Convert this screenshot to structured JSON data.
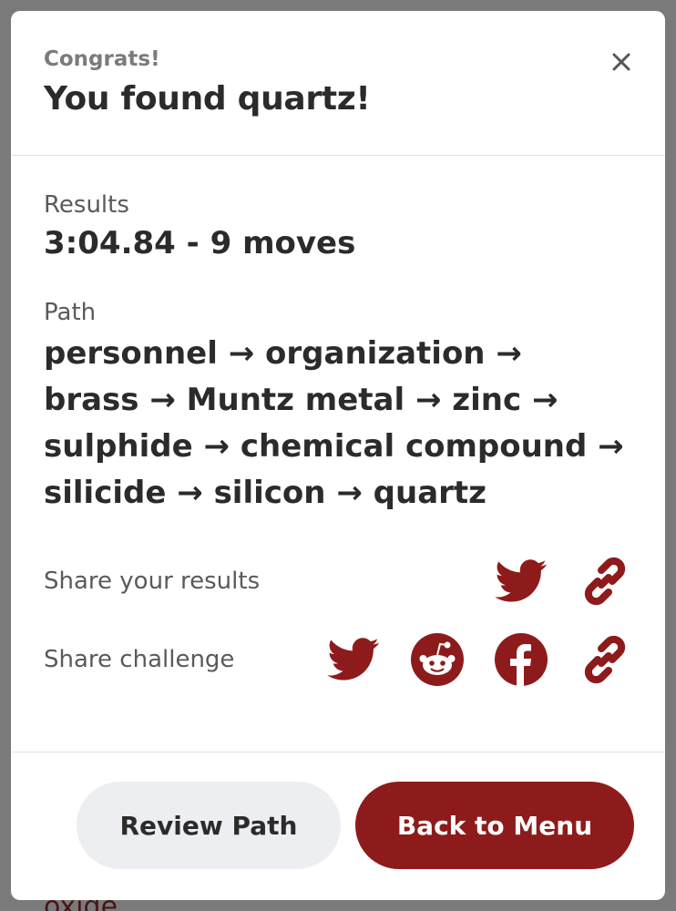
{
  "backdrop": {
    "text": "oxide"
  },
  "modal": {
    "eyebrow": "Congrats!",
    "title": "You found quartz!",
    "results": {
      "label": "Results",
      "value": "3:04.84 - 9 moves"
    },
    "path": {
      "label": "Path",
      "value": "personnel → organization → brass → Muntz metal → zinc → sulphide → chemical compound → silicide → silicon → quartz"
    },
    "share_results": {
      "label": "Share your results",
      "icons": [
        "twitter-icon",
        "link-icon"
      ]
    },
    "share_challenge": {
      "label": "Share challenge",
      "icons": [
        "twitter-icon",
        "reddit-icon",
        "facebook-icon",
        "link-icon"
      ]
    },
    "footer": {
      "review_label": "Review Path",
      "menu_label": "Back to Menu"
    }
  },
  "colors": {
    "accent": "#8e1b1b",
    "secondary_button": "#eceef1",
    "overlay": "#7a7a7a"
  }
}
